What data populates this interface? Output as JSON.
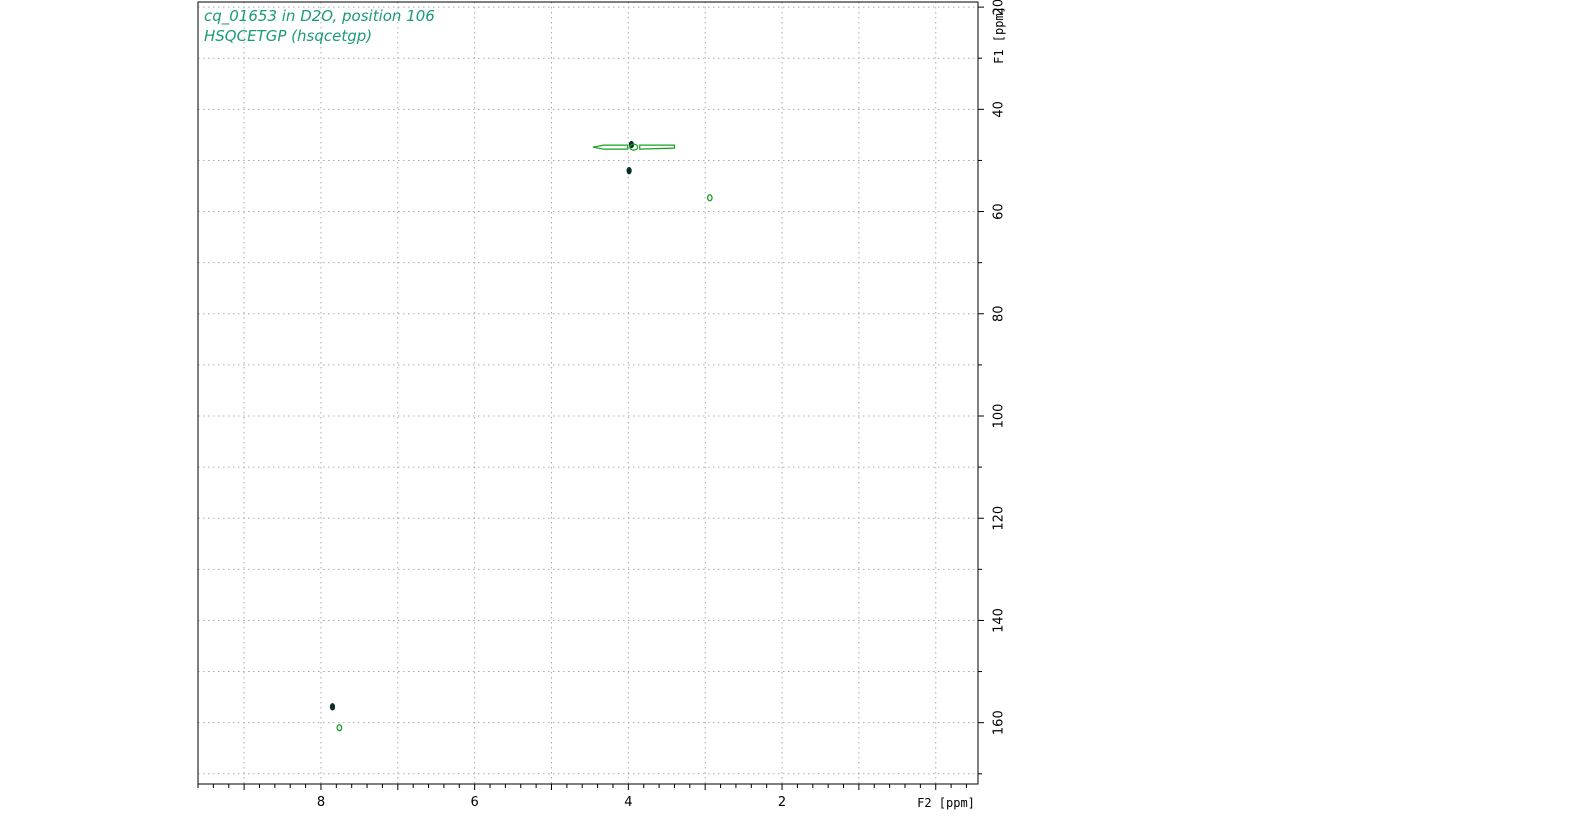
{
  "chart_data": {
    "type": "contour",
    "title_lines": [
      "cq_01653 in D2O, position 106",
      "HSQCETGP (hsqcetgp)"
    ],
    "xlabel": "F2 [ppm]",
    "ylabel": "F1 [ppm]",
    "x_reversed": true,
    "y_reversed": true,
    "xlim": [
      9.6,
      -0.55
    ],
    "ylim": [
      19,
      172
    ],
    "x_ticks": [
      8,
      6,
      4,
      2
    ],
    "y_ticks": [
      20,
      40,
      60,
      80,
      100,
      120,
      140,
      160
    ],
    "grid": true,
    "colors": {
      "positive": "#15a022",
      "negative": "#0a2e2a",
      "title": "#1a9a78",
      "grid": "#aaaaaa"
    },
    "peaks": [
      {
        "f2": 3.96,
        "f1": 46.9,
        "sign": "negative",
        "shape": "dot"
      },
      {
        "f2": 3.93,
        "f1": 47.4,
        "sign": "positive",
        "shape": "wide",
        "f2_from": 4.46,
        "f2_to": 3.4
      },
      {
        "f2": 3.99,
        "f1": 52.0,
        "sign": "negative",
        "shape": "dot"
      },
      {
        "f2": 2.94,
        "f1": 57.3,
        "sign": "positive",
        "shape": "ring"
      },
      {
        "f2": 7.85,
        "f1": 156.9,
        "sign": "negative",
        "shape": "dot"
      },
      {
        "f2": 7.76,
        "f1": 161.0,
        "sign": "positive",
        "shape": "ring"
      }
    ]
  }
}
